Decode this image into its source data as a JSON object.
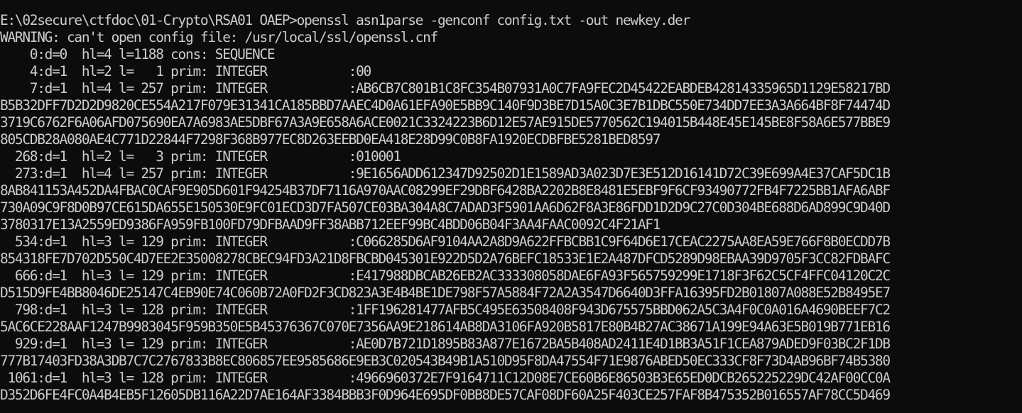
{
  "terminal": {
    "lines": [
      "E:\\02secure\\ctfdoc\\01-Crypto\\RSA01 OAEP>openssl asn1parse -genconf config.txt -out newkey.der",
      "WARNING: can't open config file: /usr/local/ssl/openssl.cnf",
      "    0:d=0  hl=4 l=1188 cons: SEQUENCE",
      "    4:d=1  hl=2 l=   1 prim: INTEGER           :00",
      "    7:d=1  hl=4 l= 257 prim: INTEGER           :AB6CB7C801B1C8FC354B07931A0C7FA9FEC2D45422EABDEB42814335965D1129E58217BD",
      "B5B32DFF7D2D2D9820CE554A217F079E31341CA185BBD7AAEC4D0A61EFA90E5BB9C140F9D3BE7D15A0C3E7B1DBC550E734DD7EE3A3A664BF8F74474D",
      "3719C6762F6A06AFD075690EA7A6983AE5DBF67A3A9E658A6ACE0021C3324223B6D12E57AE915DE5770562C194015B448E45E145BE8F58A6E577BBE9",
      "805CDB28A080AE4C771D22844F7298F368B977EC8D263EEBD0EA418E28D99C0B8FA1920ECDBFBE5281BED8597",
      "  268:d=1  hl=2 l=   3 prim: INTEGER           :010001",
      "  273:d=1  hl=4 l= 257 prim: INTEGER           :9E1656ADD612347D92502D1E1589AD3A023D7E3E512D16141D72C39E699A4E37CAF5DC1B",
      "8AB841153A452DA4FBAC0CAF9E905D601F94254B37DF7116A970AAC08299EF29DBF6428BA2202B8E8481E5EBF9F6CF93490772FB4F7225BB1AFA6ABF",
      "730A09C9F8D0B97CE615DA655E150530E9FC01ECD3D7FA507CE03BA304A8C7ADAD3F5901AA6D62F8A3E86FDD1D2D9C27C0D304BE688D6AD899C9D40D",
      "3780317E13A2559ED9386FA959FB100FD79DFBAAD9FF38ABB712EEF99BC4BDD06B04F3AA4FAAC0092C4F21AF1",
      "  534:d=1  hl=3 l= 129 prim: INTEGER           :C066285D6AF9104AA2A8D9A622FFBCBB1C9F64D6E17CEAC2275AA8EA59E766F8B0ECDD7B",
      "854318FE7D702D550C4D7EE2E35008278CBEC94FD3A21D8FBCBD045301E922D5D2A76BEFC18533E1E2A487DFCD5289D98EBAA39D9705F3CC82FDBAFC",
      "  666:d=1  hl=3 l= 129 prim: INTEGER           :E417988DBCAB26EB2AC333308058DAE6FA93F565759299E1718F3F62C5CF4FFC04120C2C",
      "D515D9FE4BB8046DE25147C4EB90E74C060B72A0FD2F3CD823A3E4B4BE1DE798F57A5884F72A2A3547D6640D3FFA16395FD2B01807A088E52B8495E7",
      "  798:d=1  hl=3 l= 128 prim: INTEGER           :1FF196281477AFB5C495E63508408F943D675575BBD062A5C3A4F0C0A016A4690BEEF7C2",
      "5AC6CE228AAF1247B9983045F959B350E5B45376367C070E7356AA9E218614AB8DA3106FA920B5817E80B4B27AC38671A199E94A63E5B019B771EB16",
      "  929:d=1  hl=3 l= 129 prim: INTEGER           :AE0D7B721D1895B83A877E1672BA5B408AD2411E4D1BB3A51F1CEA879ADED9F03BC2F1DB",
      "777B17403FD38A3DB7C7C2767833B8EC806857EE9585686E9EB3C020543B49B1A510D95F8DA47554F71E9876ABED50EC333CF8F73D4AB96BF74B5380",
      " 1061:d=1  hl=3 l= 128 prim: INTEGER           :4966960372E7F9164711C12D08E7CE60B6E86503B3E65ED0DCB265225229DC42AF00CC0A",
      "D352D6FE4FC0A4B4EB5F12605DB116A22D7AE164AF3384BBB3F0D964E695DF0BB8DE57CAF08DF60A25F403CE257FAF8B475352B016557AF78CC5D469"
    ]
  }
}
